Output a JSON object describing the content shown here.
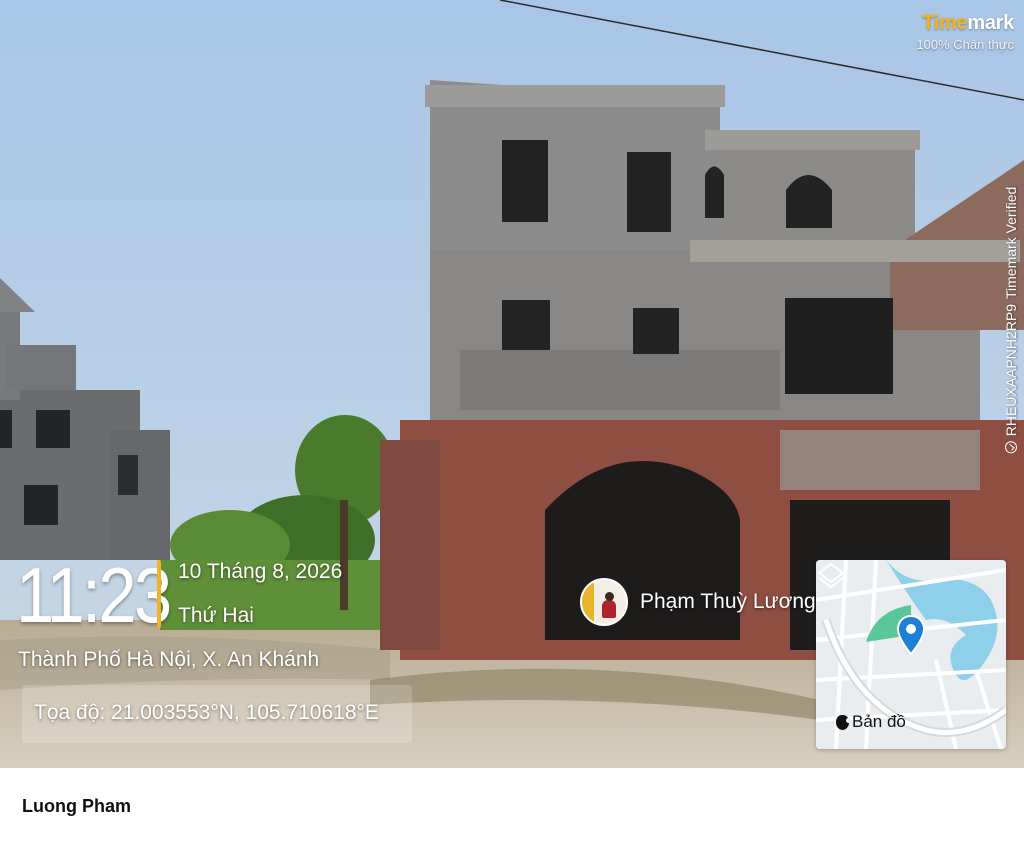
{
  "brand": {
    "logo_time": "Time",
    "logo_mark": "mark",
    "tagline": "100% Chân thực"
  },
  "verification": {
    "code": "RHEUXAAPNH2RP9",
    "label": "Timemark Verified",
    "icon": "check-circle-icon"
  },
  "overlay": {
    "time": "11:23",
    "date": "10 Tháng 8, 2026",
    "weekday": "Thứ Hai",
    "location": "Thành Phố Hà Nội, X. An Khánh",
    "coordinates": "Tọa độ: 21.003553°N, 105.710618°E",
    "accent_color": "#f5b21c"
  },
  "user": {
    "name": "Phạm Thuỳ Lương",
    "avatar_icon": "user-avatar"
  },
  "map": {
    "label": "Bản đồ",
    "brand_icon": "apple-icon",
    "pin_icon": "location-pin-icon",
    "layers_icon": "layers-icon"
  },
  "footer": {
    "author": "Luong Pham"
  }
}
